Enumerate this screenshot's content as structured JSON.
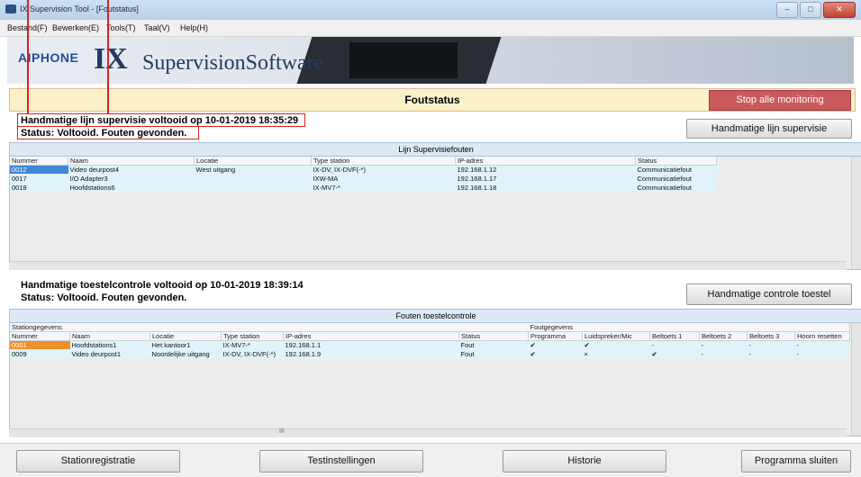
{
  "window": {
    "title": "IX Supervision Tool - [Foutstatus]",
    "buttons": {
      "minimize": "–",
      "maximize": "□",
      "close": "✕"
    }
  },
  "menu": [
    "Bestand(F)",
    "Bewerken(E)",
    "Tools(T)",
    "Taal(V)",
    "Help(H)"
  ],
  "banner": {
    "brand": "AIPHONE",
    "ix": "IX",
    "product": "SupervisionSoftware"
  },
  "header": {
    "status_title": "Foutstatus",
    "stop_button": "Stop alle monitoring"
  },
  "line_supervision": {
    "completed_msg": "Handmatige lijn supervisie voltooid op 10-01-2019 18:35:29",
    "status_msg": "Status: Voltooid. Fouten gevonden.",
    "button": "Handmatige lijn supervisie",
    "grid_title": "Lijn Supervisiefouten",
    "columns": [
      "Nummer",
      "Naam",
      "Locatie",
      "Type station",
      "IP-adres",
      "Status"
    ],
    "rows": [
      [
        "0012",
        "Video deurpost4",
        "West uitgang",
        "IX-DV, IX-DVF(-*)",
        "192.168.1.12",
        "Communicatiefout"
      ],
      [
        "0017",
        "I/O Adapter3",
        "",
        "IXW-MA",
        "192.168.1.17",
        "Communicatiefout"
      ],
      [
        "0018",
        "Hoofdstations6",
        "",
        "IX-MV7-*",
        "192.168.1.18",
        "Communicatiefout"
      ]
    ]
  },
  "device_check": {
    "completed_msg": "Handmatige toestelcontrole voltooid op 10-01-2019 18:39:14",
    "status_msg": "Status: Voltooid. Fouten gevonden.",
    "button": "Handmatige controle toestel",
    "grid_title": "Fouten toestelcontrole",
    "group_station": "Stationgegevens",
    "group_fault": "Foutgegevens",
    "columns": [
      "Nummer",
      "Naam",
      "Locatie",
      "Type station",
      "IP-adres",
      "Status",
      "Programma",
      "Luidspreker/Mic",
      "Beltoets 1",
      "Beltoets 2",
      "Beltoets 3",
      "Hoorn resetten"
    ],
    "rows": [
      [
        "0001",
        "Hoofdstations1",
        "Het kantoor1",
        "IX-MV7-*",
        "192.168.1.1",
        "Fout",
        "✔",
        "✔",
        "-",
        "-",
        "-",
        "-"
      ],
      [
        "0009",
        "Video deurpost1",
        "Noordelijke uitgang",
        "IX-DV, IX-DVF(-*)",
        "192.168.1.9",
        "Fout",
        "✔",
        "×",
        "✔",
        "-",
        "-",
        "-"
      ]
    ]
  },
  "footer": {
    "station_registration": "Stationregistratie",
    "test_settings": "Testinstellingen",
    "history": "Historie",
    "close_program": "Programma sluiten"
  },
  "scroll": {
    "h_thumb": "III"
  }
}
